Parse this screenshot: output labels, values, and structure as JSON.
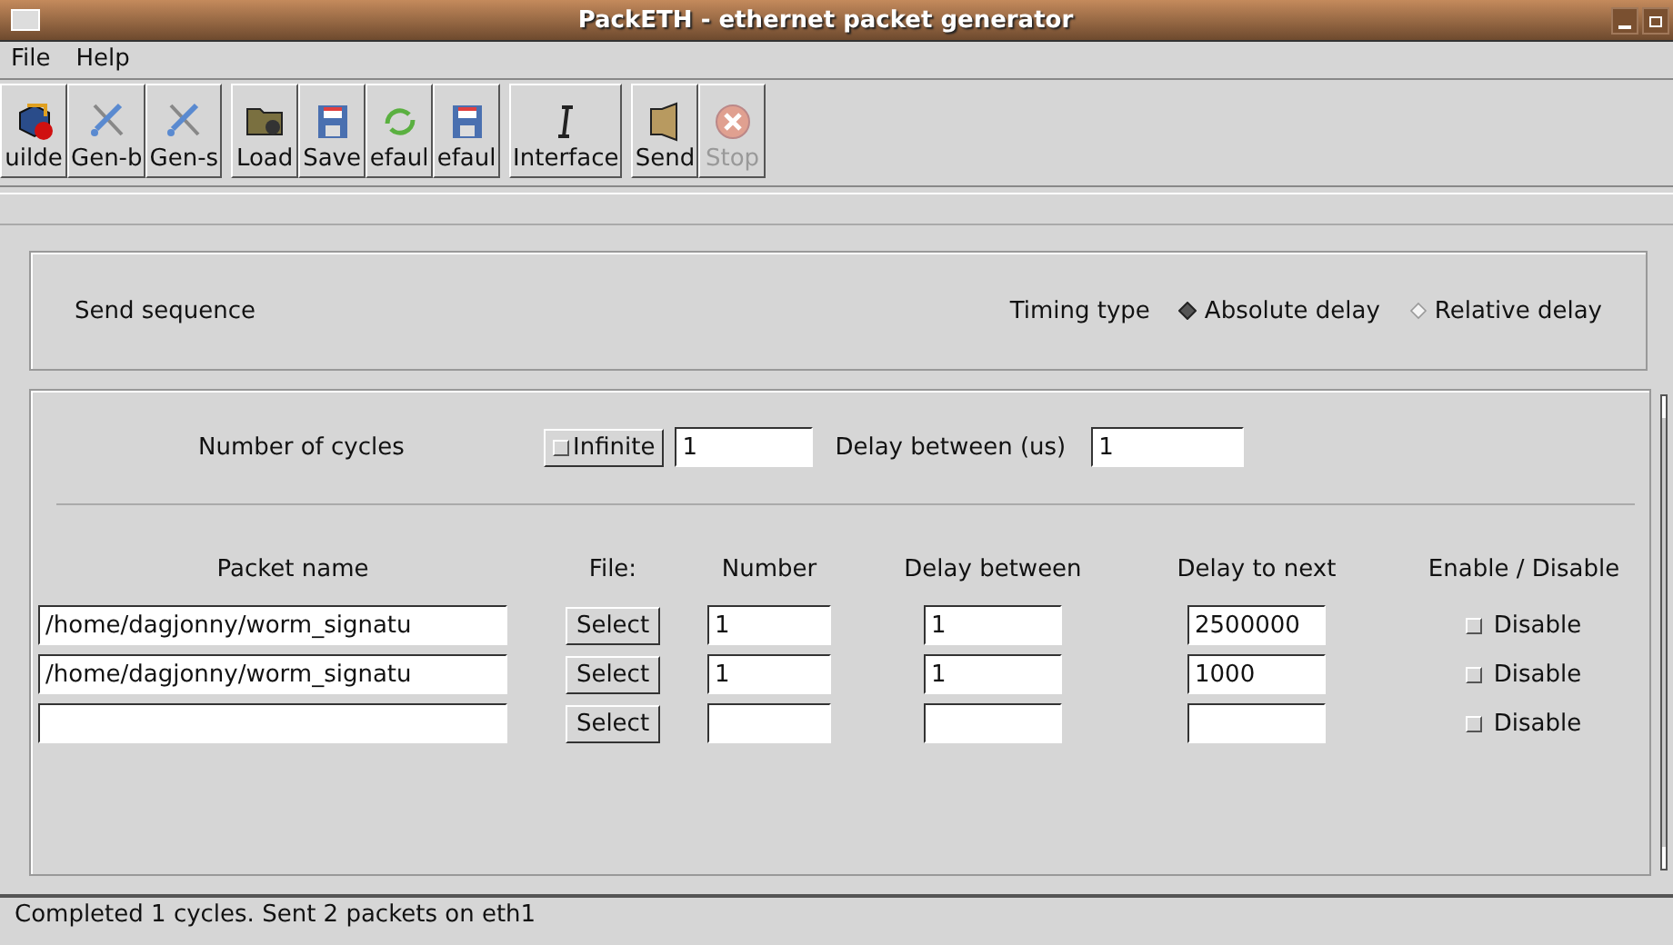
{
  "window": {
    "title": "PackETH - ethernet packet generator"
  },
  "menu": [
    "File",
    "Help"
  ],
  "toolbar": [
    {
      "buttons": [
        {
          "label": "uilde",
          "kind": "builder",
          "disabled": false
        },
        {
          "label": "Gen-b",
          "kind": "tools",
          "disabled": false
        },
        {
          "label": "Gen-s",
          "kind": "tools",
          "disabled": false
        }
      ]
    },
    {
      "buttons": [
        {
          "label": "Load",
          "kind": "folder",
          "disabled": false
        },
        {
          "label": "Save",
          "kind": "floppy",
          "disabled": false
        },
        {
          "label": "efaul",
          "kind": "recycle",
          "disabled": false
        },
        {
          "label": "efaul",
          "kind": "floppy",
          "disabled": false
        }
      ]
    },
    {
      "buttons": [
        {
          "label": "Interface",
          "kind": "ibeam",
          "disabled": false
        }
      ]
    },
    {
      "buttons": [
        {
          "label": "Send",
          "kind": "speaker",
          "disabled": false
        },
        {
          "label": "Stop",
          "kind": "stop",
          "disabled": true
        }
      ]
    }
  ],
  "sequence": {
    "title": "Send sequence",
    "timing_label": "Timing type",
    "timing_options": [
      {
        "label": "Absolute delay",
        "selected": true
      },
      {
        "label": "Relative delay",
        "selected": false
      }
    ]
  },
  "cycles": {
    "label": "Number of cycles",
    "infinite": {
      "label": "Infinite",
      "checked": false
    },
    "count": "1",
    "delay_label": "Delay between (us)",
    "delay": "1"
  },
  "table": {
    "columns": [
      "Packet name",
      "File:",
      "Number",
      "Delay between",
      "Delay to next",
      "Enable / Disable"
    ],
    "rows": [
      {
        "packet": "/home/dagjonny/worm_signatu",
        "button": "Select",
        "number": "1",
        "delay_between": "1",
        "delay_next": "2500000",
        "disable": {
          "label": "Disable",
          "checked": false
        }
      },
      {
        "packet": "/home/dagjonny/worm_signatu",
        "button": "Select",
        "number": "1",
        "delay_between": "1",
        "delay_next": "1000",
        "disable": {
          "label": "Disable",
          "checked": false
        }
      },
      {
        "button": "Select",
        "disable": {
          "label": "Disable",
          "checked": false
        }
      }
    ]
  },
  "status_bar": "Completed 1 cycles. Sent 2 packets on eth1"
}
